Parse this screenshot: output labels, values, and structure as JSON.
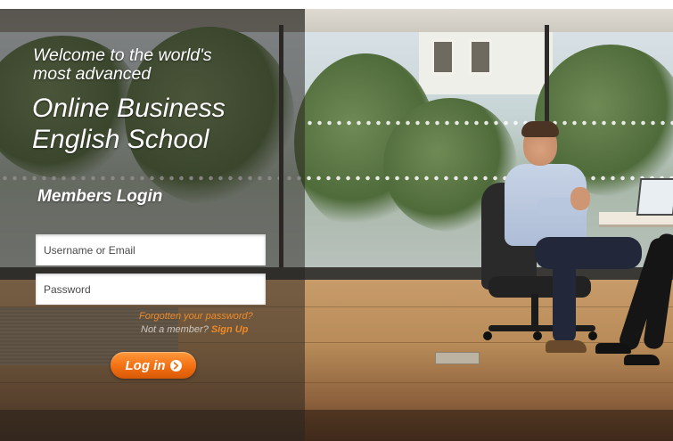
{
  "hero": {
    "welcome_line1": "Welcome to the world's",
    "welcome_line2": "most advanced",
    "school_line1": "Online Business",
    "school_line2": "English School"
  },
  "login": {
    "heading": "Members Login",
    "username_placeholder": "Username or Email",
    "password_placeholder": "Password",
    "forgot_link": "Forgotten your password?",
    "not_member_text": "Not a member?",
    "signup_link": "Sign Up",
    "login_button": "Log in"
  },
  "icons": {
    "login_arrow": "arrow-right-circle-icon"
  },
  "colors": {
    "accent": "#f26f12",
    "link": "#f08a28",
    "overlay": "rgba(40,36,32,0.52)"
  }
}
